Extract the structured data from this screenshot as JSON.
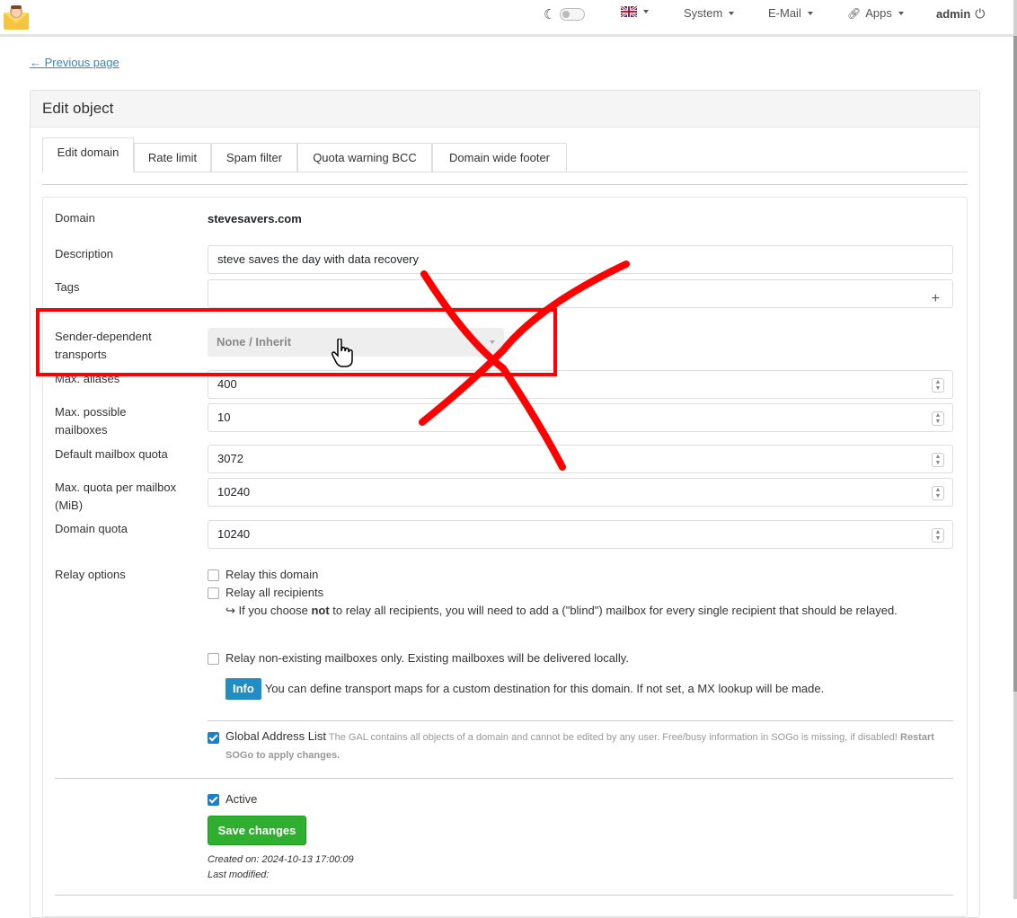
{
  "navbar": {
    "language": "EN",
    "system": "System",
    "email": "E-Mail",
    "apps": "Apps",
    "user": "admin"
  },
  "previous_page": "← Previous page",
  "panel_title": "Edit object",
  "tabs": [
    "Edit domain",
    "Rate limit",
    "Spam filter",
    "Quota warning BCC",
    "Domain wide footer"
  ],
  "form": {
    "domain_label": "Domain",
    "domain_value": "stevesavers.com",
    "description_label": "Description",
    "description_value": "steve saves the day with data recovery",
    "tags_label": "Tags",
    "sender_transport_label": "Sender-dependent transports",
    "sender_transport_value": "None / Inherit",
    "max_aliases_label": "Max. aliases",
    "max_aliases_value": "400",
    "max_mailboxes_label": "Max. possible mailboxes",
    "max_mailboxes_value": "10",
    "default_quota_label": "Default mailbox quota",
    "default_quota_value": "3072",
    "max_quota_label": "Max. quota per mailbox (MiB)",
    "max_quota_value": "10240",
    "domain_quota_label": "Domain quota",
    "domain_quota_value": "10240",
    "relay_label": "Relay options",
    "relay_domain": "Relay this domain",
    "relay_all": "Relay all recipients",
    "relay_help_pre": "↪ If you choose ",
    "relay_help_bold": "not",
    "relay_help_post": " to relay all recipients, you will need to add a (\"blind\") mailbox for every single recipient that should be relayed.",
    "relay_unknown": "Relay non-existing mailboxes only. Existing mailboxes will be delivered locally.",
    "info_badge": "Info",
    "info_text": "You can define transport maps for a custom destination for this domain. If not set, a MX lookup will be made.",
    "gal_label": "Global Address List",
    "gal_help": "The GAL contains all objects of a domain and cannot be edited by any user. Free/busy information in SOGo is missing, if disabled!",
    "gal_restart": "Restart SOGo to apply changes.",
    "active_label": "Active",
    "save_button": "Save changes",
    "created_on": "Created on: 2024-10-13 17:00:09",
    "last_modified": "Last modified:"
  },
  "colors": {
    "annotation": "#ff0000",
    "save_button": "#2fae2f",
    "checkbox": "#1f7ec9",
    "link": "#2c89c5"
  }
}
